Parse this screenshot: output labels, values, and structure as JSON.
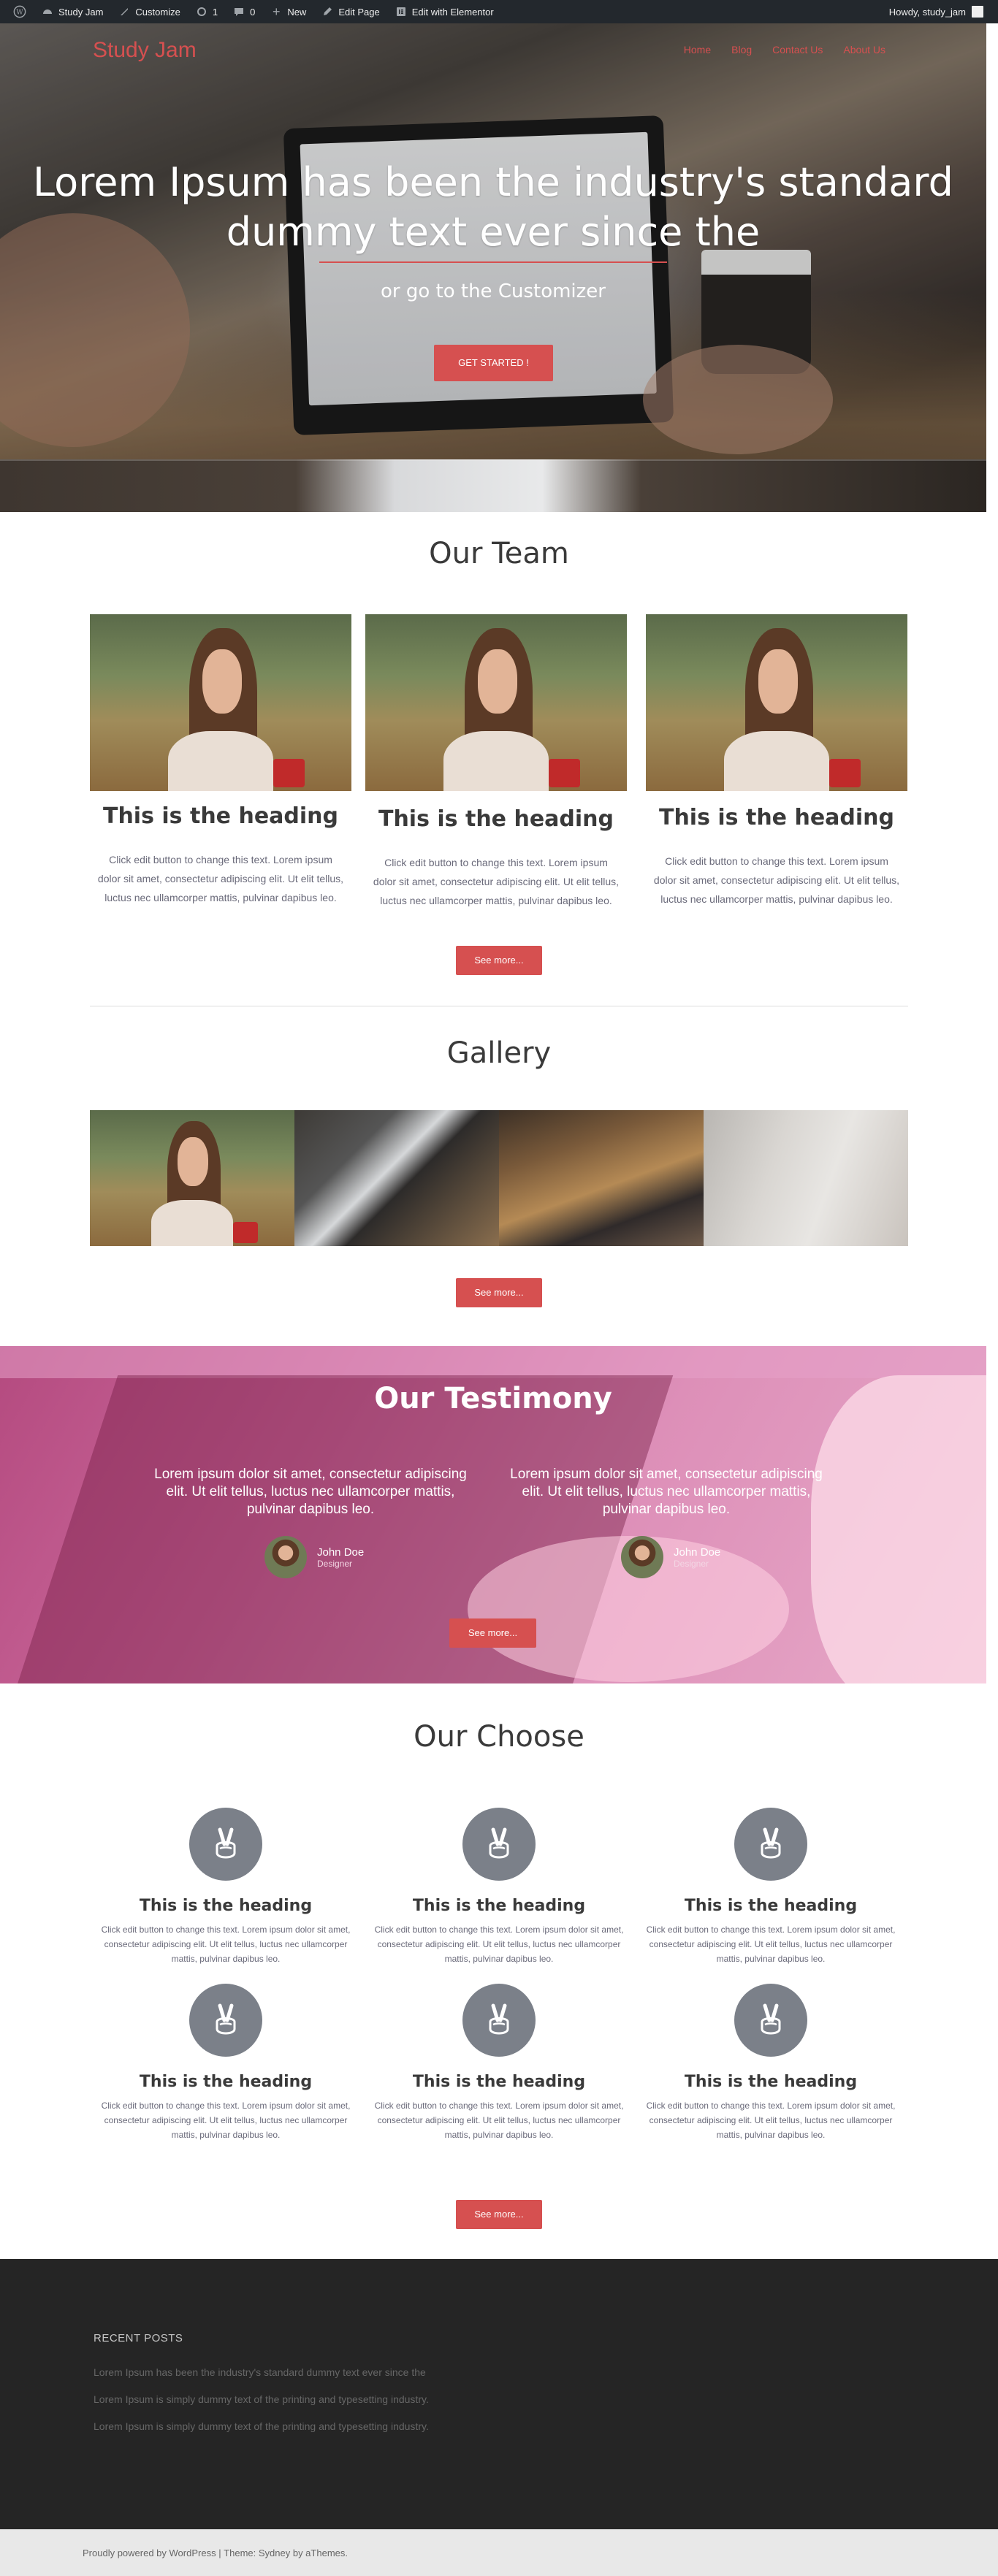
{
  "adminbar": {
    "site": "Study Jam",
    "customize": "Customize",
    "updates": "1",
    "comments": "0",
    "new": "New",
    "edit_page": "Edit Page",
    "elementor": "Edit with Elementor",
    "howdy": "Howdy, study_jam"
  },
  "header": {
    "site_title": "Study Jam",
    "nav": [
      "Home",
      "Blog",
      "Contact Us",
      "About Us"
    ]
  },
  "hero": {
    "title": "Lorem Ipsum has been the industry's standard dummy text ever since the",
    "subtitle": "or go to the Customizer",
    "button": "GET STARTED !"
  },
  "team": {
    "title": "Our Team",
    "members": [
      {
        "heading": "This is the heading",
        "text": "Click edit button to change this text. Lorem ipsum dolor sit amet, consectetur adipiscing elit. Ut elit tellus, luctus nec ullamcorper mattis, pulvinar dapibus leo."
      },
      {
        "heading": "This is the heading",
        "text": "Click edit button to change this text. Lorem ipsum dolor sit amet, consectetur adipiscing elit. Ut elit tellus, luctus nec ullamcorper mattis, pulvinar dapibus leo."
      },
      {
        "heading": "This is the heading",
        "text": "Click edit button to change this text. Lorem ipsum dolor sit amet, consectetur adipiscing elit. Ut elit tellus, luctus nec ullamcorper mattis, pulvinar dapibus leo."
      }
    ],
    "button": "See more..."
  },
  "gallery": {
    "title": "Gallery",
    "button": "See more..."
  },
  "testimony": {
    "title": "Our Testimony",
    "items": [
      {
        "quote": "Lorem ipsum dolor sit amet, consectetur adipiscing elit. Ut elit tellus, luctus nec ullamcorper mattis, pulvinar dapibus leo.",
        "name": "John Doe",
        "role": "Designer"
      },
      {
        "quote": "Lorem ipsum dolor sit amet, consectetur adipiscing elit. Ut elit tellus, luctus nec ullamcorper mattis, pulvinar dapibus leo.",
        "name": "John Doe",
        "role": "Designer"
      }
    ],
    "button": "See more..."
  },
  "choose": {
    "title": "Our Choose",
    "items": [
      {
        "heading": "This is the heading",
        "text": "Click edit button to change this text. Lorem ipsum dolor sit amet, consectetur adipiscing elit. Ut elit tellus, luctus nec ullamcorper mattis, pulvinar dapibus leo."
      },
      {
        "heading": "This is the heading",
        "text": "Click edit button to change this text. Lorem ipsum dolor sit amet, consectetur adipiscing elit. Ut elit tellus, luctus nec ullamcorper mattis, pulvinar dapibus leo."
      },
      {
        "heading": "This is the heading",
        "text": "Click edit button to change this text. Lorem ipsum dolor sit amet, consectetur adipiscing elit. Ut elit tellus, luctus nec ullamcorper mattis, pulvinar dapibus leo."
      },
      {
        "heading": "This is the heading",
        "text": "Click edit button to change this text. Lorem ipsum dolor sit amet, consectetur adipiscing elit. Ut elit tellus, luctus nec ullamcorper mattis, pulvinar dapibus leo."
      },
      {
        "heading": "This is the heading",
        "text": "Click edit button to change this text. Lorem ipsum dolor sit amet, consectetur adipiscing elit. Ut elit tellus, luctus nec ullamcorper mattis, pulvinar dapibus leo."
      },
      {
        "heading": "This is the heading",
        "text": "Click edit button to change this text. Lorem ipsum dolor sit amet, consectetur adipiscing elit. Ut elit tellus, luctus nec ullamcorper mattis, pulvinar dapibus leo."
      }
    ],
    "button": "See more..."
  },
  "footer": {
    "widget_title": "RECENT POSTS",
    "posts": [
      "Lorem Ipsum has been the industry's standard dummy text ever since the",
      "Lorem Ipsum is simply dummy text of the printing and typesetting industry.",
      "Lorem Ipsum is simply dummy text of the printing and typesetting industry."
    ],
    "credit_prefix": "Proudly powered by WordPress",
    "credit_sep": " | ",
    "credit_theme": "Theme: Sydney by aThemes."
  },
  "colors": {
    "accent": "#d65050",
    "adminbar": "#23282d",
    "footer_bg": "#252525",
    "icon_circle": "#7b8089"
  }
}
